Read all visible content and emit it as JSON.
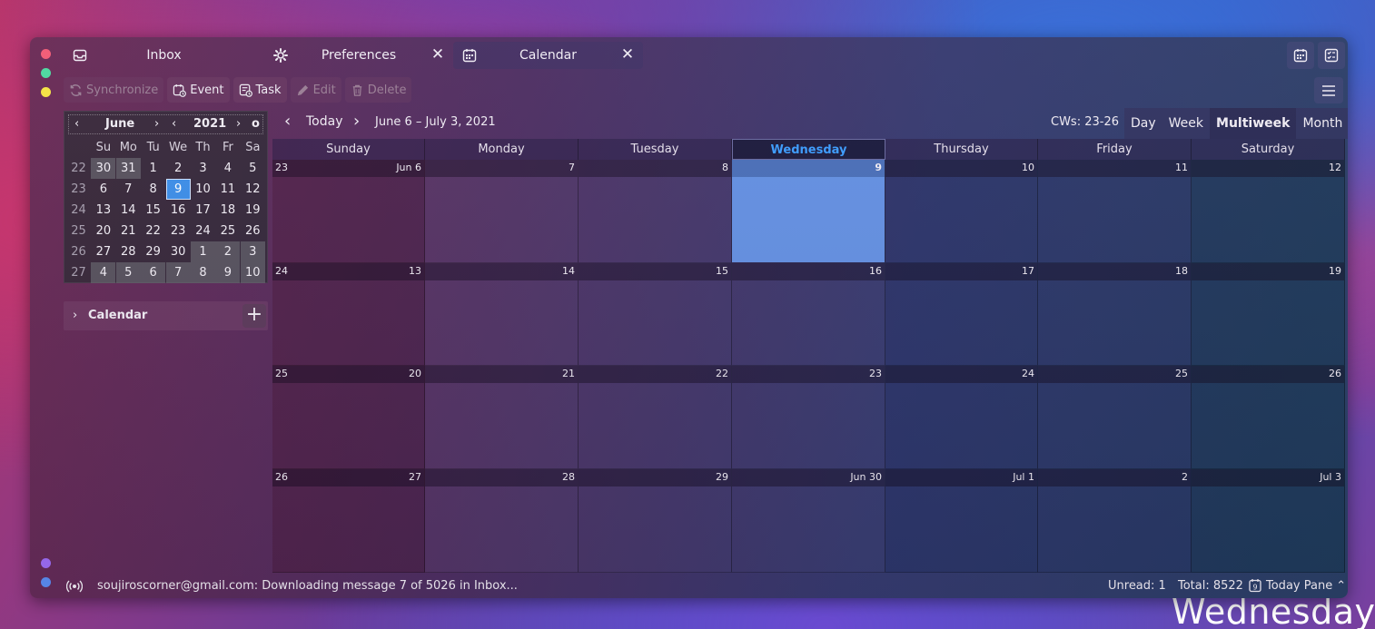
{
  "wallpaper": {
    "clock_text": "Wednesday"
  },
  "tabs": [
    {
      "label": "Inbox",
      "icon": "inbox-icon"
    },
    {
      "label": "Preferences",
      "icon": "gear-icon"
    },
    {
      "label": "Calendar",
      "icon": "calendar-icon"
    }
  ],
  "toolbar": {
    "synchronize": "Synchronize",
    "event": "Event",
    "task": "Task",
    "edit": "Edit",
    "delete": "Delete"
  },
  "minimonth": {
    "month": "June",
    "year": "2021",
    "dow": [
      "Su",
      "Mo",
      "Tu",
      "We",
      "Th",
      "Fr",
      "Sa"
    ],
    "weeks": [
      {
        "wk": "22",
        "days": [
          "30",
          "31",
          "1",
          "2",
          "3",
          "4",
          "5"
        ]
      },
      {
        "wk": "23",
        "days": [
          "6",
          "7",
          "8",
          "9",
          "10",
          "11",
          "12"
        ]
      },
      {
        "wk": "24",
        "days": [
          "13",
          "14",
          "15",
          "16",
          "17",
          "18",
          "19"
        ]
      },
      {
        "wk": "25",
        "days": [
          "20",
          "21",
          "22",
          "23",
          "24",
          "25",
          "26"
        ]
      },
      {
        "wk": "26",
        "days": [
          "27",
          "28",
          "29",
          "30",
          "1",
          "2",
          "3"
        ]
      },
      {
        "wk": "27",
        "days": [
          "4",
          "5",
          "6",
          "7",
          "8",
          "9",
          "10"
        ]
      }
    ],
    "selected": "9"
  },
  "calendar_list": {
    "label": "Calendar"
  },
  "nav": {
    "today": "Today",
    "range": "June 6 – July 3, 2021",
    "cws": "CWs: 23-26"
  },
  "views": [
    "Day",
    "Week",
    "Multiweek",
    "Month"
  ],
  "selected_view": "Multiweek",
  "day_headers": [
    "Sunday",
    "Monday",
    "Tuesday",
    "Wednesday",
    "Thursday",
    "Friday",
    "Saturday"
  ],
  "selected_day_header": "Wednesday",
  "multiweek": [
    {
      "wk": "23",
      "days": [
        "Jun 6",
        "7",
        "8",
        "9",
        "10",
        "11",
        "12"
      ]
    },
    {
      "wk": "24",
      "days": [
        "13",
        "14",
        "15",
        "16",
        "17",
        "18",
        "19"
      ]
    },
    {
      "wk": "25",
      "days": [
        "20",
        "21",
        "22",
        "23",
        "24",
        "25",
        "26"
      ]
    },
    {
      "wk": "26",
      "days": [
        "27",
        "28",
        "29",
        "Jun 30",
        "Jul 1",
        "2",
        "Jul 3"
      ]
    }
  ],
  "status": {
    "message": "soujiroscorner@gmail.com: Downloading message 7 of 5026 in Inbox...",
    "unread": "Unread: 1",
    "total": "Total: 8522",
    "today_pane": "Today Pane",
    "today_pane_icon_digit": "9"
  }
}
